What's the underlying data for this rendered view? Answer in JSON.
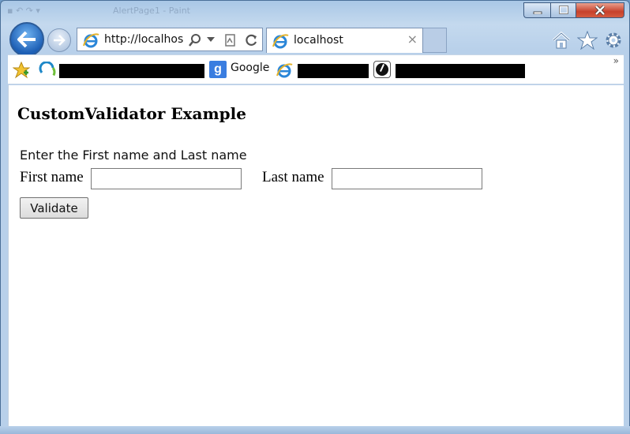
{
  "window": {
    "title": "AlertPage1 - Paint",
    "controls": {
      "minimize": "minimize",
      "maximize": "maximize",
      "close": "close"
    }
  },
  "toolbar": {
    "address": "http://localhos",
    "tab_title": "localhost",
    "tab_close": "×"
  },
  "favorites": {
    "google_label": "Google",
    "more": "»"
  },
  "page": {
    "heading": "CustomValidator Example",
    "instruction": "Enter the First name and Last name",
    "first_name_label": "First name",
    "first_name_value": "",
    "last_name_label": "Last name",
    "last_name_value": "",
    "validate_label": "Validate"
  },
  "colors": {
    "frame": "#b8d0ea",
    "close_button": "#c7412b",
    "back_button": "#1d5fb5"
  }
}
